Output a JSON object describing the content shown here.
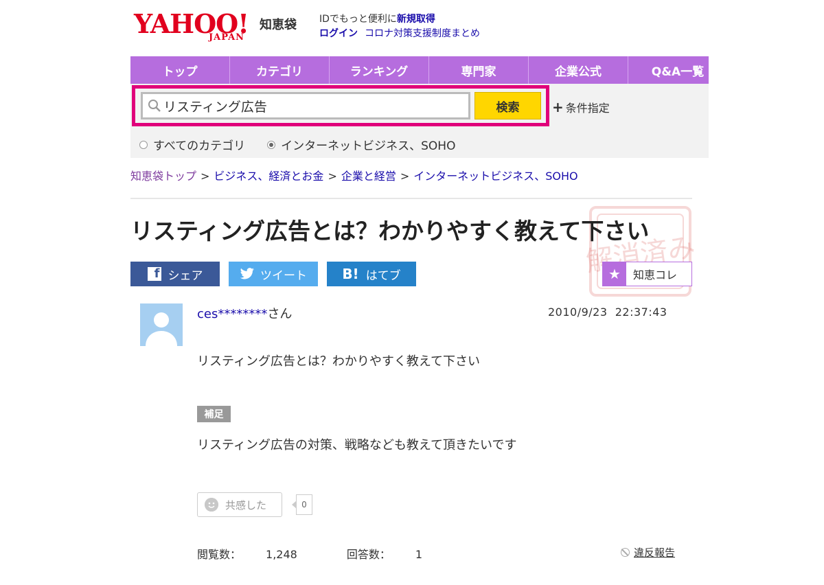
{
  "header": {
    "logo_word": "YAHOO!",
    "logo_sub": "JAPAN",
    "service_name": "知恵袋",
    "promo_text": "IDでもっと便利に",
    "promo_link": "新規取得",
    "login": "ログイン",
    "covid_link": "コロナ対策支援制度まとめ"
  },
  "nav": {
    "items": [
      "トップ",
      "カテゴリ",
      "ランキング",
      "専門家",
      "企業公式",
      "Q&A一覧"
    ],
    "bg_color": "#b66dde"
  },
  "search": {
    "query": "リスティング広告",
    "button": "検索",
    "conditions": "条件指定",
    "radio_all": "すべてのカテゴリ",
    "radio_category": "インターネットビジネス、SOHO",
    "selected": "radio_category",
    "highlight_color": "#e0007a"
  },
  "breadcrumb": [
    "知恵袋トップ",
    "ビジネス、経済とお金",
    "企業と経営",
    "インターネットビジネス、SOHO"
  ],
  "question": {
    "title": "リスティング広告とは？わかりやすく教えて下さい",
    "user": "ces********",
    "user_suffix": "さん",
    "date": "2010/9/23",
    "time": "22:37:43",
    "body": "リスティング広告とは？わかりやすく教えて下さい",
    "supplement_label": "補足",
    "supplement": "リスティング広告の対策、戦略なども教えて頂きたいです",
    "empathy_label": "共感した",
    "empathy_count": "0",
    "views_label": "閲覧数：",
    "views": "1,248",
    "answers_label": "回答数：",
    "answers": "1",
    "report": "違反報告",
    "stamp": "解消済み"
  },
  "share": {
    "facebook": "シェア",
    "twitter": "ツイート",
    "hatena": "はてブ",
    "collect": "知恵コレ"
  },
  "icons": {
    "search": "magnifier-icon",
    "facebook": "facebook-icon",
    "twitter": "twitter-bird-icon",
    "hatena": "hatena-bookmark-icon",
    "collect": "star-icon"
  }
}
